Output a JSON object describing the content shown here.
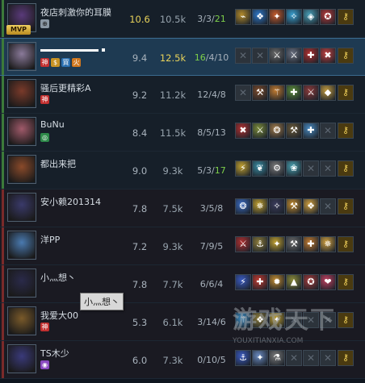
{
  "players": [
    {
      "name": "夜店刺激你的耳膜",
      "mvp": "MVP",
      "badges": [
        {
          "icon": "bag-icon",
          "glyph": "⊕",
          "cls": "b-silver"
        }
      ],
      "score": "10.6",
      "gold": "10.5k",
      "kda": {
        "k": "3",
        "d": "3",
        "a": "21",
        "highlight_a": true
      },
      "team": "win",
      "items": [
        "⌁",
        "❖",
        "✦",
        "✧",
        "◈",
        "✪",
        "⚷"
      ],
      "colors": [
        "#b28a2a",
        "#2f78c8",
        "#c65b2a",
        "#3aa0d0",
        "#4aa0b8",
        "#b63a3a",
        "#c6a020"
      ]
    },
    {
      "name": "",
      "redacted": true,
      "badges": [
        {
          "icon": "shen-icon",
          "glyph": "神",
          "cls": "b-shen"
        },
        {
          "icon": "dollar-icon",
          "glyph": "$",
          "cls": "b-gold"
        },
        {
          "icon": "buy-icon",
          "glyph": "買",
          "cls": "b-blue"
        },
        {
          "icon": "fire-icon",
          "glyph": "火",
          "cls": "b-orange"
        }
      ],
      "score": "9.4",
      "gold": "12.5k",
      "gold_hi": true,
      "kda": {
        "k": "16",
        "d": "4",
        "a": "10",
        "highlight_k": true
      },
      "team": "win",
      "me": true,
      "items": [
        "✕",
        "✕",
        "⚔",
        "⚔",
        "✚",
        "✖",
        "⚷"
      ],
      "colors": [
        null,
        null,
        "#6a6a6a",
        "#6a7080",
        "#b03030",
        "#c04040",
        "#c6a020"
      ]
    },
    {
      "name": "骚后更精彩A",
      "badges": [
        {
          "icon": "shen-icon",
          "glyph": "神",
          "cls": "b-shen"
        }
      ],
      "score": "9.2",
      "gold": "11.2k",
      "kda": {
        "k": "12",
        "d": "4",
        "a": "8"
      },
      "team": "win",
      "items": [
        "✕",
        "⚒",
        "⚚",
        "✚",
        "⚔",
        "◆",
        "⚷"
      ],
      "colors": [
        null,
        "#7a4a2a",
        "#c07a30",
        "#5a8a3a",
        "#8a3a3a",
        "#c09a40",
        "#c6a020"
      ]
    },
    {
      "name": "BuNu",
      "badges": [
        {
          "icon": "shield-icon",
          "glyph": "◎",
          "cls": "b-green"
        }
      ],
      "score": "8.4",
      "gold": "11.5k",
      "kda": {
        "k": "8",
        "d": "5",
        "a": "13"
      },
      "team": "win",
      "items": [
        "✖",
        "⚔",
        "❂",
        "⚒",
        "✚",
        "✕",
        "⚷"
      ],
      "colors": [
        "#b03030",
        "#7a8a3a",
        "#a07a4a",
        "#6a5a3a",
        "#4a8ac0",
        null,
        "#c6a020"
      ]
    },
    {
      "name": "都出来把",
      "badges": [],
      "score": "9.0",
      "gold": "9.3k",
      "kda": {
        "k": "5",
        "d": "3",
        "a": "17",
        "highlight_a": true
      },
      "team": "win",
      "items": [
        "⚡",
        "❦",
        "⚙",
        "❀",
        "✕",
        "✕",
        "⚷"
      ],
      "colors": [
        "#c0a030",
        "#3a8aa0",
        "#7a7a7a",
        "#4aa0b0",
        null,
        null,
        "#c6a020"
      ]
    },
    {
      "name": "安小赖201314",
      "badges": [],
      "score": "7.8",
      "gold": "7.5k",
      "kda": {
        "k": "3",
        "d": "5",
        "a": "8"
      },
      "team": "lose",
      "items": [
        "❂",
        "✵",
        "✧",
        "⚒",
        "❖",
        "✕",
        "⚷"
      ],
      "colors": [
        "#3a6ac0",
        "#c0a030",
        "#3a3a5a",
        "#c08a30",
        "#d0a040",
        null,
        "#c6a020"
      ]
    },
    {
      "name": "洋PP",
      "badges": [],
      "score": "7.2",
      "gold": "9.3k",
      "kda": {
        "k": "7",
        "d": "9",
        "a": "5"
      },
      "team": "lose",
      "items": [
        "⚔",
        "⚓",
        "✦",
        "⚒",
        "✚",
        "✵",
        "⚷"
      ],
      "colors": [
        "#b03030",
        "#8a7a3a",
        "#c0a030",
        "#6a6a6a",
        "#c07a30",
        "#d0a040",
        "#c6a020"
      ]
    },
    {
      "name": "小灬想丶",
      "badges": [],
      "score": "7.8",
      "gold": "7.7k",
      "kda": {
        "k": "6",
        "d": "6",
        "a": "4"
      },
      "team": "lose",
      "items": [
        "⚡",
        "✚",
        "✹",
        "▲",
        "✪",
        "❤",
        "⚷"
      ],
      "colors": [
        "#3a5ac0",
        "#c03a30",
        "#c08a30",
        "#8a8a3a",
        "#a03a3a",
        "#c04060",
        "#c6a020"
      ]
    },
    {
      "name": "我爱大00",
      "badges": [
        {
          "icon": "shen-icon",
          "glyph": "神",
          "cls": "b-shen"
        }
      ],
      "score": "5.3",
      "gold": "6.1k",
      "kda": {
        "k": "3",
        "d": "14",
        "a": "6"
      },
      "team": "lose",
      "items": [
        "⚚",
        "❖",
        "✦",
        "✕",
        "✕",
        "✕",
        "⚷"
      ],
      "colors": [
        "#3a8ac0",
        "#8a7a3a",
        "#c0a030",
        null,
        null,
        null,
        "#c6a020"
      ]
    },
    {
      "name": "TS木少",
      "badges": [
        {
          "icon": "ghost-icon",
          "glyph": "◉",
          "cls": "b-purple"
        }
      ],
      "score": "6.0",
      "gold": "7.3k",
      "kda": {
        "k": "0",
        "d": "10",
        "a": "5"
      },
      "team": "lose",
      "items": [
        "⚓",
        "✦",
        "⚗",
        "✕",
        "✕",
        "✕",
        "⚷"
      ],
      "colors": [
        "#3a5ac0",
        "#6a8ac0",
        "#7a7a7a",
        null,
        null,
        null,
        "#c6a020"
      ]
    }
  ],
  "portrait_colors": [
    "#5a3a7a",
    "#8a7a9a",
    "#7a3a2a",
    "#a05a6a",
    "#8a4a2a",
    "#3a3a6a",
    "#4a7ab0",
    "#2a2a4a",
    "#7a5a2a",
    "#3a3a7a"
  ],
  "tooltip": "小灬想丶",
  "watermark": {
    "main": "游戏天下",
    "sub": "YOUXITIANXIA.COM"
  }
}
